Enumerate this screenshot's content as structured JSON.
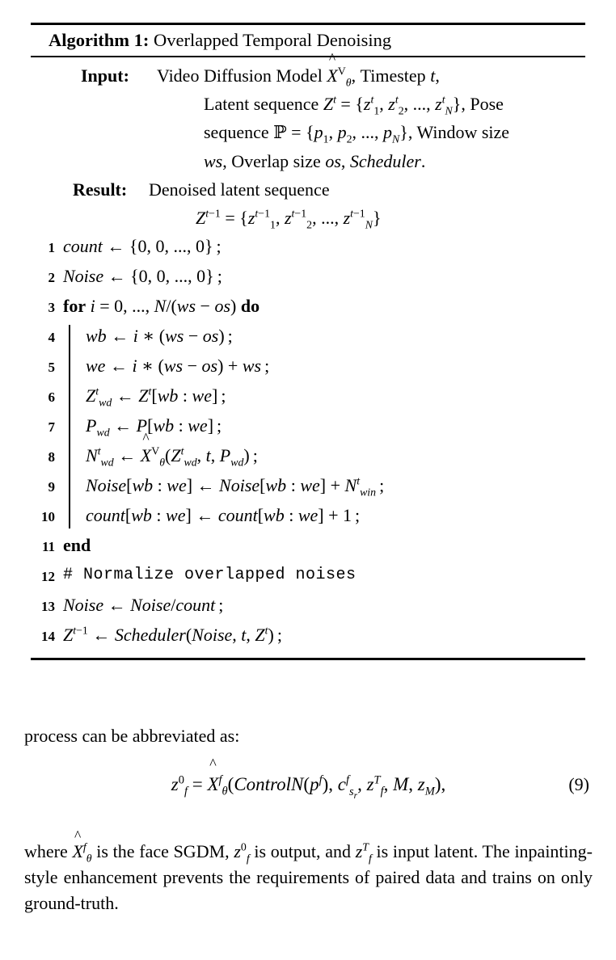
{
  "algorithm": {
    "label": "Algorithm 1:",
    "title": "Overlapped Temporal Denoising",
    "input_label": "Input:",
    "result_label": "Result:",
    "input_lines": [
      "Video Diffusion Model X̂ᵥₜₐₑ, Timestep t,",
      "Latent sequence Zᵗ = {z₁ᵗ, z₂ᵗ, ..., zₙᵗ}, Pose",
      "sequence P = {p₁, p₂, ..., pₙ}, Window size",
      "ws, Overlap size os, Scheduler."
    ],
    "result_lines": [
      "Denoised latent sequence",
      "Zᵗ⁻¹ = {z₁ᵗ⁻¹, z₂ᵗ⁻¹, ..., zₙᵗ⁻¹}"
    ],
    "lines": [
      {
        "no": "1",
        "indent": 0,
        "text": "count ← {0, 0, ..., 0} ;"
      },
      {
        "no": "2",
        "indent": 0,
        "text": "Noise ← {0, 0, ..., 0} ;"
      },
      {
        "no": "3",
        "indent": 0,
        "text": "for i = 0, ..., N/(ws − os) do"
      },
      {
        "no": "4",
        "indent": 1,
        "text": "wb ← i ∗ (ws − os) ;"
      },
      {
        "no": "5",
        "indent": 1,
        "text": "we ← i ∗ (ws − os) + ws ;"
      },
      {
        "no": "6",
        "indent": 1,
        "text": "Zᵗ_wd ← Zᵗ[wb : we] ;"
      },
      {
        "no": "7",
        "indent": 1,
        "text": "P_wd ← P[wb : we] ;"
      },
      {
        "no": "8",
        "indent": 1,
        "text": "Nᵗ_wd ← X̂ᵥ₀(Zᵗ_wd, t, P_wd) ;"
      },
      {
        "no": "9",
        "indent": 1,
        "text": "Noise[wb : we] ← Noise[wb : we] + Nᵗ_win ;"
      },
      {
        "no": "10",
        "indent": 1,
        "text": "count[wb : we] ← count[wb : we] + 1 ;"
      },
      {
        "no": "11",
        "indent": 0,
        "text": "end"
      },
      {
        "no": "12",
        "indent": 0,
        "text": "# Normalize overlapped noises"
      },
      {
        "no": "13",
        "indent": 0,
        "text": "Noise ← Noise/count ;"
      },
      {
        "no": "14",
        "indent": 0,
        "text": "Zᵗ⁻¹ ← Scheduler(Noise, t, Zᵗ) ;"
      }
    ],
    "comment_line_12": "# Normalize overlapped noises"
  },
  "body": {
    "paragraph_1": "process can be abbreviated as:",
    "equation_9": {
      "number": "(9)",
      "latex": "z_f^0 = \\hat{X}_\\theta^f (ControlN(p^f), c_{s_r}^f, z_f^T, M, z_M),"
    },
    "paragraph_2_parts": {
      "p1": "where ",
      "p2": " is the face SGDM, ",
      "p3": " is output, and ",
      "p4": " is input latent.  The inpainting-style enhancement prevents the requirements of paired data and trains on only ground-truth."
    }
  }
}
